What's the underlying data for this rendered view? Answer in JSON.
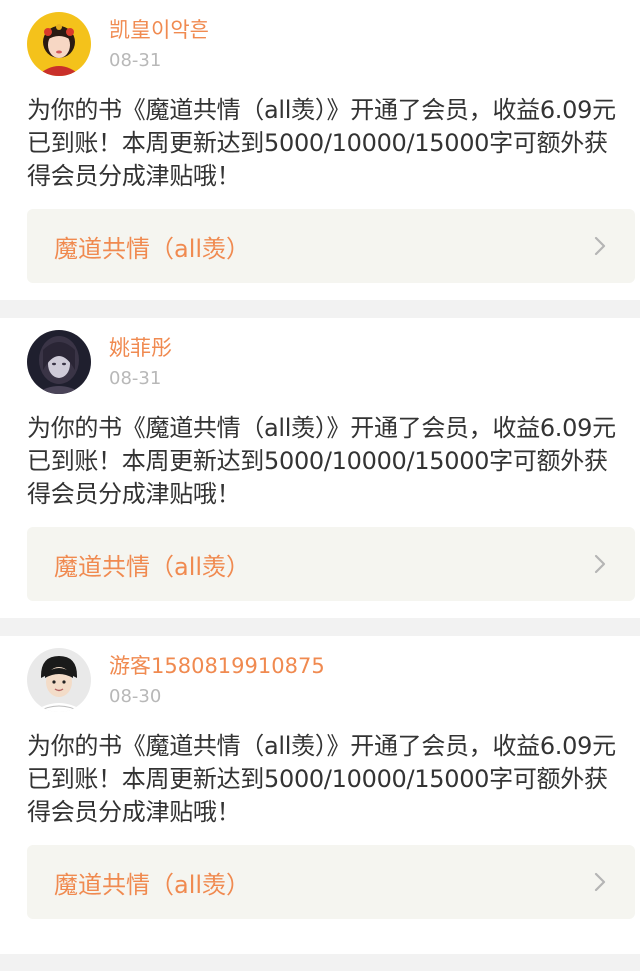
{
  "posts": [
    {
      "username": "凯皇이악흔",
      "date": "08-31",
      "avatar_icon": "user-avatar-blonde-icon",
      "message": "为你的书《魔道共情（all羡）》开通了会员，收益6.09元已到账！本周更新达到5000/10000/15000字可额外获得会员分成津贴哦！",
      "book_title": "魔道共情（all羡）"
    },
    {
      "username": "姚菲彤",
      "date": "08-31",
      "avatar_icon": "user-avatar-dark-icon",
      "message": "为你的书《魔道共情（all羡）》开通了会员，收益6.09元已到账！本周更新达到5000/10000/15000字可额外获得会员分成津贴哦！",
      "book_title": "魔道共情（all羡）"
    },
    {
      "username": "游客1580819910875",
      "date": "08-30",
      "avatar_icon": "user-avatar-boy-icon",
      "message": "为你的书《魔道共情（all羡）》开通了会员，收益6.09元已到账！本周更新达到5000/10000/15000字可额外获得会员分成津贴哦！",
      "book_title": "魔道共情（all羡）"
    }
  ],
  "colors": {
    "accent": "#f08a50",
    "date_gray": "#b8b8b8",
    "text": "#333333",
    "link_bg": "#f5f5f0",
    "page_bg": "#f2f2f2"
  }
}
